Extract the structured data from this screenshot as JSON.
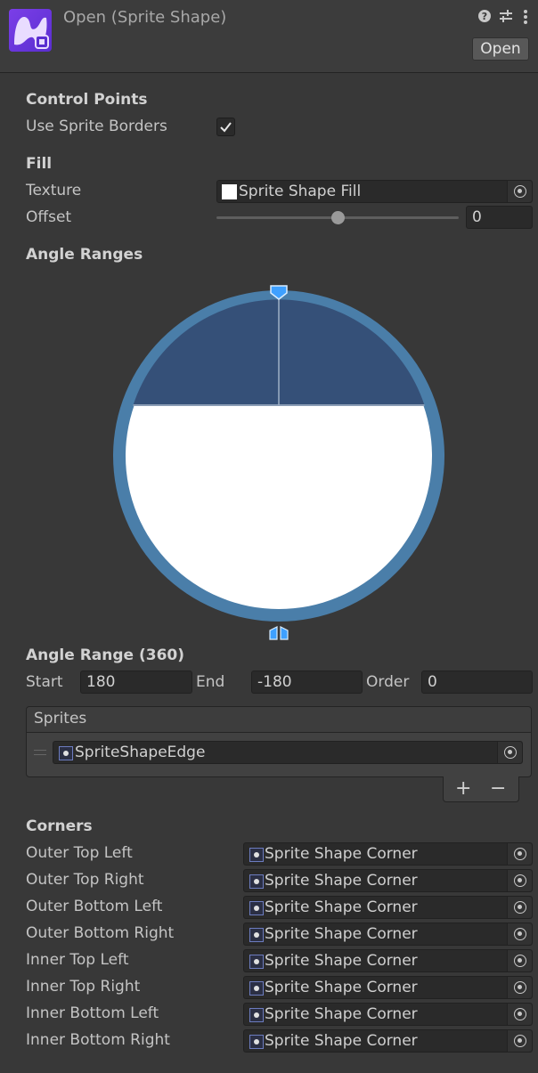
{
  "header": {
    "title": "Open (Sprite Shape)",
    "open_button": "Open",
    "icons": [
      "help-icon",
      "preset-icon",
      "more-icon"
    ]
  },
  "control_points": {
    "title": "Control Points",
    "use_sprite_borders_label": "Use Sprite Borders",
    "use_sprite_borders_checked": true
  },
  "fill": {
    "title": "Fill",
    "texture_label": "Texture",
    "texture_value": "Sprite Shape Fill",
    "offset_label": "Offset",
    "offset_value": "0",
    "offset_slider_fraction": 0.5
  },
  "angle_ranges": {
    "title": "Angle Ranges",
    "colors": {
      "ring": "#4a7ea9",
      "selected_range": "#355078",
      "fill": "#ffffff"
    }
  },
  "angle_range": {
    "title": "Angle Range (360)",
    "start_label": "Start",
    "start_value": "180",
    "end_label": "End",
    "end_value": "-180",
    "order_label": "Order",
    "order_value": "0"
  },
  "sprites": {
    "header": "Sprites",
    "items": [
      "SpriteShapeEdge"
    ],
    "add_label": "+",
    "remove_label": "−"
  },
  "corners": {
    "title": "Corners",
    "items": [
      {
        "label": "Outer Top Left",
        "value": "Sprite Shape Corner"
      },
      {
        "label": "Outer Top Right",
        "value": "Sprite Shape Corner"
      },
      {
        "label": "Outer Bottom Left",
        "value": "Sprite Shape Corner"
      },
      {
        "label": "Outer Bottom Right",
        "value": "Sprite Shape Corner"
      },
      {
        "label": "Inner Top Left",
        "value": "Sprite Shape Corner"
      },
      {
        "label": "Inner Top Right",
        "value": "Sprite Shape Corner"
      },
      {
        "label": "Inner Bottom Left",
        "value": "Sprite Shape Corner"
      },
      {
        "label": "Inner Bottom Right",
        "value": "Sprite Shape Corner"
      }
    ]
  }
}
